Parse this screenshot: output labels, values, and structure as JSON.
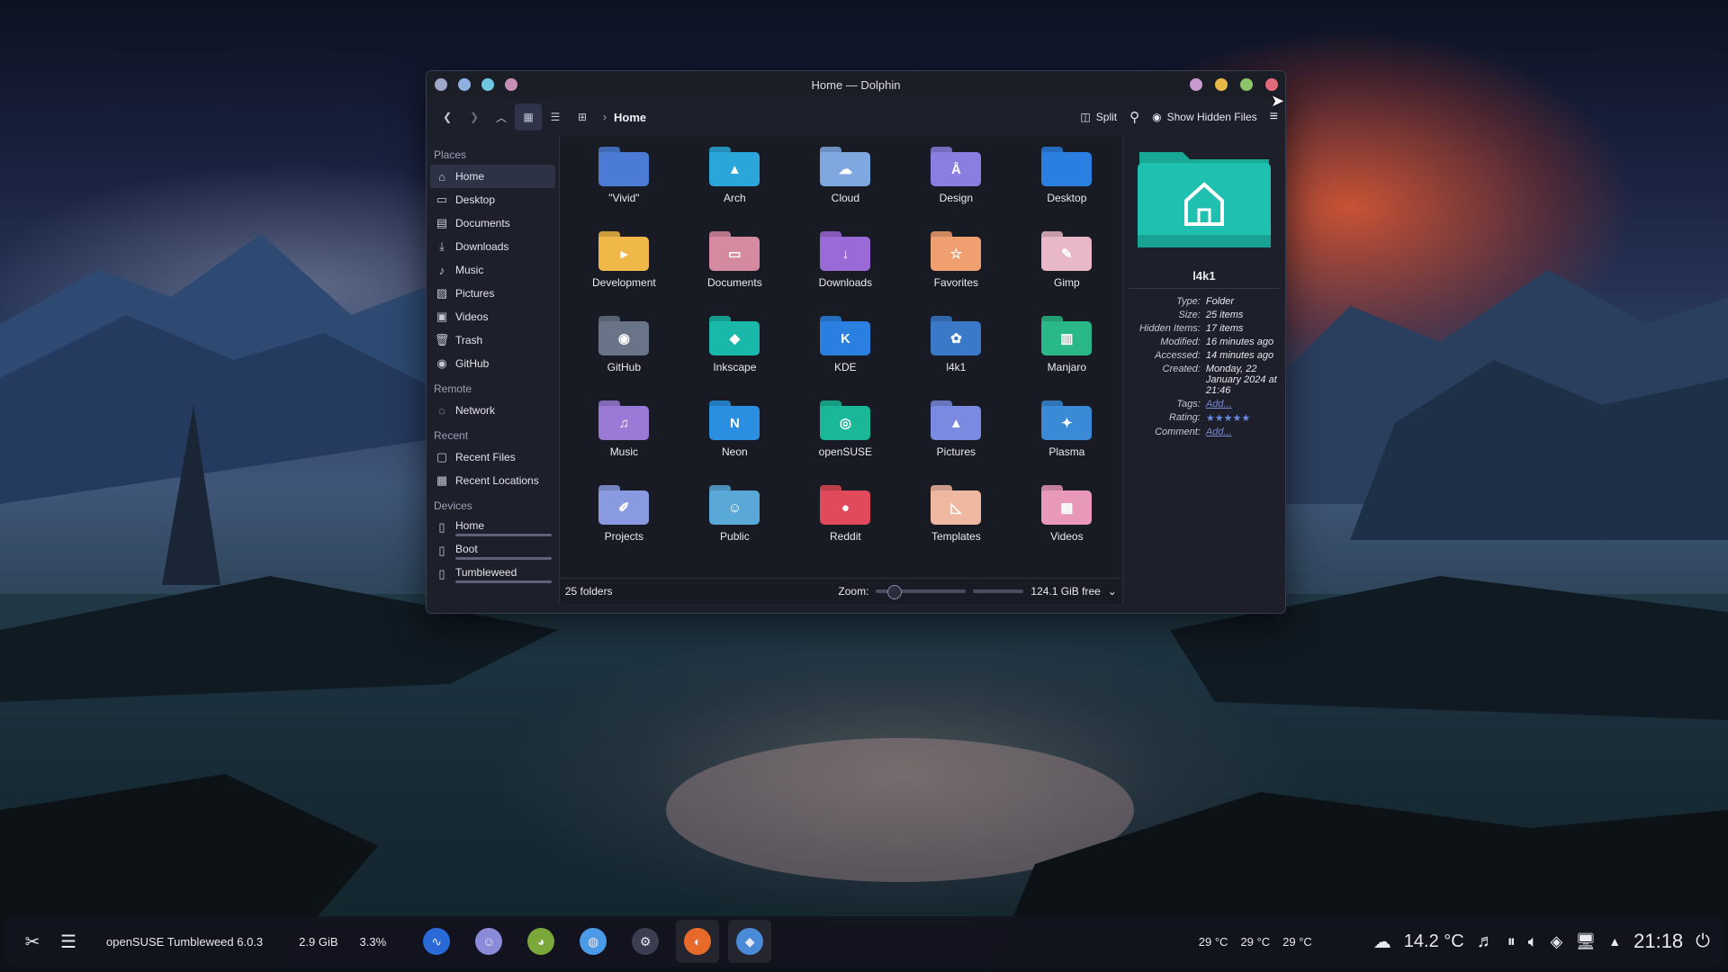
{
  "window": {
    "title": "Home — Dolphin",
    "colors": {
      "dot1": "#9fa6c8",
      "dot2": "#8fb0e0",
      "dot3": "#6fc6e0",
      "dot4": "#c88fb4",
      "min": "#c89cd0",
      "max": "#e8b848",
      "ok": "#8cc46a",
      "close": "#e06a7a"
    }
  },
  "toolbar": {
    "breadcrumb": "Home",
    "split_label": "Split",
    "hidden_label": "Show Hidden Files"
  },
  "sidebar": {
    "places_header": "Places",
    "places": [
      {
        "label": "Home",
        "icon": "home-icon"
      },
      {
        "label": "Desktop",
        "icon": "desktop-icon"
      },
      {
        "label": "Documents",
        "icon": "documents-icon"
      },
      {
        "label": "Downloads",
        "icon": "downloads-icon"
      },
      {
        "label": "Music",
        "icon": "music-icon"
      },
      {
        "label": "Pictures",
        "icon": "pictures-icon"
      },
      {
        "label": "Videos",
        "icon": "videos-icon"
      },
      {
        "label": "Trash",
        "icon": "trash-icon"
      },
      {
        "label": "GitHub",
        "icon": "github-icon"
      }
    ],
    "remote_header": "Remote",
    "remote": [
      {
        "label": "Network",
        "icon": "network-icon"
      }
    ],
    "recent_header": "Recent",
    "recent": [
      {
        "label": "Recent Files",
        "icon": "recent-files-icon"
      },
      {
        "label": "Recent Locations",
        "icon": "recent-locations-icon"
      }
    ],
    "devices_header": "Devices",
    "devices": [
      {
        "label": "Home",
        "icon": "drive-icon"
      },
      {
        "label": "Boot",
        "icon": "drive-icon"
      },
      {
        "label": "Tumbleweed",
        "icon": "drive-icon"
      }
    ]
  },
  "folders": [
    {
      "name": "\"Vivid\"",
      "color": "#4c7bd6",
      "glyph": ""
    },
    {
      "name": "Arch",
      "color": "#2aa7d8",
      "glyph": "▲"
    },
    {
      "name": "Cloud",
      "color": "#7fa8e0",
      "glyph": "☁"
    },
    {
      "name": "Design",
      "color": "#8a7fe0",
      "glyph": "Å"
    },
    {
      "name": "Desktop",
      "color": "#2a7fe0",
      "glyph": ""
    },
    {
      "name": "Development",
      "color": "#f0b848",
      "glyph": "▸"
    },
    {
      "name": "Documents",
      "color": "#d68aa0",
      "glyph": "▭"
    },
    {
      "name": "Downloads",
      "color": "#9a6ad6",
      "glyph": "↓"
    },
    {
      "name": "Favorites",
      "color": "#f0a070",
      "glyph": "☆"
    },
    {
      "name": "Gimp",
      "color": "#e8b8c8",
      "glyph": "✎"
    },
    {
      "name": "GitHub",
      "color": "#6a7488",
      "glyph": "◉"
    },
    {
      "name": "Inkscape",
      "color": "#1ab8a8",
      "glyph": "◆"
    },
    {
      "name": "KDE",
      "color": "#2a7fe0",
      "glyph": "K"
    },
    {
      "name": "l4k1",
      "color": "#3a78c8",
      "glyph": "✿"
    },
    {
      "name": "Manjaro",
      "color": "#2ab888",
      "glyph": "▥"
    },
    {
      "name": "Music",
      "color": "#9a7ad6",
      "glyph": "♫"
    },
    {
      "name": "Neon",
      "color": "#2a8fe0",
      "glyph": "N"
    },
    {
      "name": "openSUSE",
      "color": "#1ab898",
      "glyph": "◎"
    },
    {
      "name": "Pictures",
      "color": "#7a8ae0",
      "glyph": "▲"
    },
    {
      "name": "Plasma",
      "color": "#3a8ad8",
      "glyph": "✦"
    },
    {
      "name": "Projects",
      "color": "#8a9ae0",
      "glyph": "✐"
    },
    {
      "name": "Public",
      "color": "#5aa8d8",
      "glyph": "☺"
    },
    {
      "name": "Reddit",
      "color": "#e04a5a",
      "glyph": "●"
    },
    {
      "name": "Templates",
      "color": "#f0b8a0",
      "glyph": "◺"
    },
    {
      "name": "Videos",
      "color": "#e898b8",
      "glyph": "▦"
    }
  ],
  "status": {
    "count": "25 folders",
    "zoom_label": "Zoom:",
    "zoom_level": 0.2,
    "free": "124.1 GiB free"
  },
  "info": {
    "name": "l4k1",
    "folder_color": "#1ab8a8",
    "rows": [
      {
        "k": "Type:",
        "v": "Folder"
      },
      {
        "k": "Size:",
        "v": "25 items"
      },
      {
        "k": "Hidden Items:",
        "v": "17 items"
      },
      {
        "k": "Modified:",
        "v": "16 minutes ago"
      },
      {
        "k": "Accessed:",
        "v": "14 minutes ago"
      },
      {
        "k": "Created:",
        "v": "Monday, 22 January 2024 at 21:46"
      }
    ],
    "tags_k": "Tags:",
    "tags_v": "Add...",
    "rating_k": "Rating:",
    "rating_stars": 5,
    "comment_k": "Comment:",
    "comment_v": "Add..."
  },
  "panel": {
    "distro": "openSUSE Tumbleweed 6.0.3",
    "mem": "2.9 GiB",
    "cpu": "3.3%",
    "temps": [
      "29 °C",
      "29 °C",
      "29 °C"
    ],
    "weather": "14.2 °C",
    "clock": "21:18",
    "apps": [
      {
        "icon": "monitor-app-icon",
        "color": "#2a6ad8"
      },
      {
        "icon": "smiley-app-icon",
        "color": "#8a8ad8"
      },
      {
        "icon": "creature-app-icon",
        "color": "#7aa83a"
      },
      {
        "icon": "globe-app-icon",
        "color": "#4a9ae8"
      },
      {
        "icon": "settings-app-icon",
        "color": "#3a3e50"
      },
      {
        "icon": "firefox-icon",
        "color": "#e86a2a"
      },
      {
        "icon": "dolphin-icon",
        "color": "#4a8ad8"
      }
    ]
  }
}
